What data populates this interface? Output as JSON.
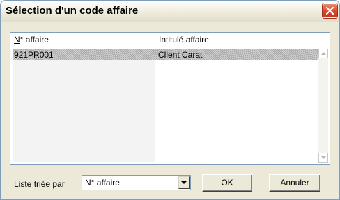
{
  "window": {
    "title": "Sélection d'un code affaire"
  },
  "list": {
    "columns": [
      {
        "prefix": "",
        "underlined": "N",
        "rest": "° affaire"
      },
      {
        "label": "Intitulé affaire"
      }
    ],
    "rows": [
      {
        "code": "921PR001",
        "name": "Client Carat"
      }
    ]
  },
  "sort": {
    "label_prefix": "Liste ",
    "label_underlined": "t",
    "label_rest": "riée par",
    "selected": "N° affaire"
  },
  "buttons": {
    "ok": "OK",
    "cancel": "Annuler"
  },
  "icons": {
    "close": "close-icon",
    "dropdown": "chevron-down-icon"
  },
  "colors": {
    "close_button": "#d8482c",
    "border": "#7f9db9",
    "dialog_bg": "#ece9d8"
  }
}
